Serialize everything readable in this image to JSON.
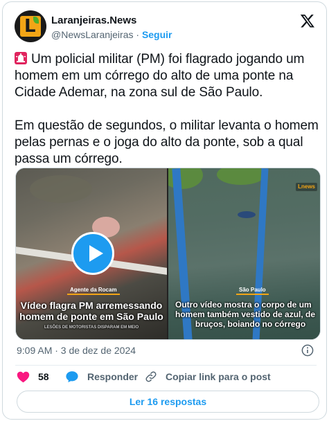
{
  "author": {
    "name": "Laranjeiras.News",
    "handle": "@NewsLaranjeiras",
    "separator": " · ",
    "follow_label": "Seguir",
    "avatar_letter": "L"
  },
  "tweet": {
    "paragraph_1": "Um policial militar (PM) foi flagrado jogando um homem em um córrego do alto de uma ponte na Cidade Ademar, na zona sul de São Paulo.",
    "paragraph_2": "Em questão de segundos, o militar levanta o homem pelas pernas e o joga do alto da ponte, sob a qual passa um córrego.",
    "leading_icon": "police-siren-icon"
  },
  "media": {
    "left": {
      "tag": "Agente da Rocam",
      "caption_line_1": "Vídeo flagra PM arremessando",
      "caption_line_2": "homem de ponte em São Paulo",
      "ticker": "LESÕES DE MOTORISTAS DISPARAM EM MEIO",
      "icon": "play-icon"
    },
    "right": {
      "badge": "Lnews",
      "tag": "São Paulo",
      "caption_line_1": "Outro vídeo mostra o corpo de um",
      "caption_line_2": "homem também vestido de azul, de",
      "caption_line_3": "bruços, boiando no córrego"
    }
  },
  "meta": {
    "timestamp": "9:09 AM · 3 de dez de 2024"
  },
  "actions": {
    "like_count": "58",
    "reply_label": "Responder",
    "copy_link_label": "Copiar link para o post"
  },
  "footer": {
    "read_replies_label": "Ler 16 respostas"
  },
  "colors": {
    "accent": "#1d9bf0",
    "like": "#f91880",
    "text": "#0f1419",
    "muted": "#536471",
    "brand_orange": "#f2a516"
  }
}
